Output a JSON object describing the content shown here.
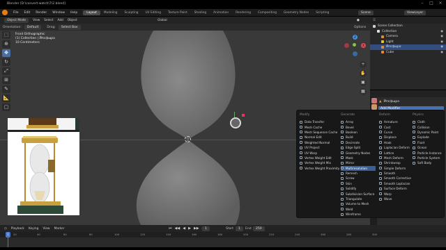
{
  "window": {
    "title": "Blender [D:\\convert-watch\\7\\2.blend]"
  },
  "menubar": {
    "menus": [
      "File",
      "Edit",
      "Render",
      "Window",
      "Help"
    ],
    "workspaces": [
      "Layout",
      "Modeling",
      "Sculpting",
      "UV Editing",
      "Texture Paint",
      "Shading",
      "Animation",
      "Rendering",
      "Compositing",
      "Geometry Nodes",
      "Scripting"
    ],
    "active_workspace": "Layout",
    "scene": "Scene",
    "view_layer": "ViewLayer"
  },
  "viewport_header": {
    "mode": "Object Mode",
    "menus": [
      "View",
      "Select",
      "Add",
      "Object"
    ],
    "orientation_label": "Orientation:",
    "orientation": "Default",
    "drag_label": "Drag:",
    "drag": "Select Box",
    "pivot": "Global",
    "options": "Options"
  },
  "viewport_overlay": {
    "view_name": "Front Orthographic",
    "collection": "(1) Collection | Йпсфщра",
    "scale": "10 Centimeters"
  },
  "toolbar": {
    "tools": [
      "select-icon",
      "cursor-icon",
      "move-icon",
      "rotate-icon",
      "scale-icon",
      "transform-icon",
      "annotate-icon",
      "measure-icon",
      "add-cube-icon"
    ],
    "active_index": 2
  },
  "outliner": {
    "title": "Scene Collection",
    "items": [
      {
        "label": "Collection",
        "color": "#e0e0e0"
      },
      {
        "label": "Camera",
        "color": "#e28b3b"
      },
      {
        "label": "Light",
        "color": "#e2c43b"
      },
      {
        "label": "Йпсфщра",
        "color": "#e28b3b"
      },
      {
        "label": "Cube",
        "color": "#e28b3b"
      }
    ],
    "selected_index": 3
  },
  "properties": {
    "object_name": "Йпсфщра",
    "add_modifier": "Add Modifier"
  },
  "modifier_menu": {
    "columns": [
      {
        "title": "Modify",
        "items": [
          "Data Transfer",
          "Mesh Cache",
          "Mesh Sequence Cache",
          "Normal Edit",
          "Weighted Normal",
          "UV Project",
          "UV Warp",
          "Vertex Weight Edit",
          "Vertex Weight Mix",
          "Vertex Weight Proximity"
        ]
      },
      {
        "title": "Generate",
        "items": [
          "Array",
          "Bevel",
          "Boolean",
          "Build",
          "Decimate",
          "Edge Split",
          "Geometry Nodes",
          "Mask",
          "Mirror",
          "Multiresolution",
          "Remesh",
          "Screw",
          "Skin",
          "Solidify",
          "Subdivision Surface",
          "Triangulate",
          "Volume to Mesh",
          "Weld",
          "Wireframe"
        ]
      },
      {
        "title": "Deform",
        "items": [
          "Armature",
          "Cast",
          "Curve",
          "Displace",
          "Hook",
          "Laplacian Deform",
          "Lattice",
          "Mesh Deform",
          "Shrinkwrap",
          "Simple Deform",
          "Smooth",
          "Smooth Corrective",
          "Smooth Laplacian",
          "Surface Deform",
          "Warp",
          "Wave"
        ]
      },
      {
        "title": "Physics",
        "items": [
          "Cloth",
          "Collision",
          "Dynamic Paint",
          "Explode",
          "Fluid",
          "Ocean",
          "Particle Instance",
          "Particle System",
          "Soft Body"
        ]
      }
    ],
    "highlighted": "Multiresolution"
  },
  "timeline": {
    "menus": [
      "Playback",
      "Keying",
      "View",
      "Marker"
    ],
    "current_frame": "1",
    "start_label": "Start",
    "start": "1",
    "end_label": "End",
    "end": "250",
    "ruler": [
      "1",
      "20",
      "40",
      "60",
      "80",
      "100",
      "120",
      "140",
      "160",
      "180",
      "200",
      "220",
      "240",
      "260",
      "280",
      "300"
    ]
  }
}
